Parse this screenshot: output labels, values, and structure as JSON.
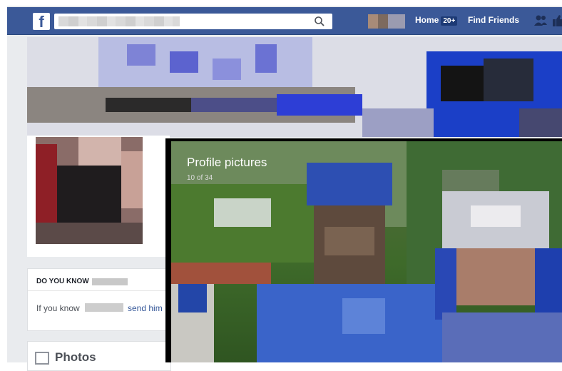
{
  "topbar": {
    "logo": "f",
    "nav_home": "Home",
    "nav_home_count": "20+",
    "nav_find_friends": "Find Friends"
  },
  "sidebar": {
    "do_you_know": {
      "title": "DO YOU KNOW",
      "text_prefix": "If you know",
      "link": "send him"
    },
    "photos": {
      "label": "Photos"
    }
  },
  "viewer": {
    "album_title": "Profile pictures",
    "position_text": "10 of 34"
  },
  "colors": {
    "brand": "#3b5998",
    "background": "#e9ebee",
    "link": "#365899"
  }
}
